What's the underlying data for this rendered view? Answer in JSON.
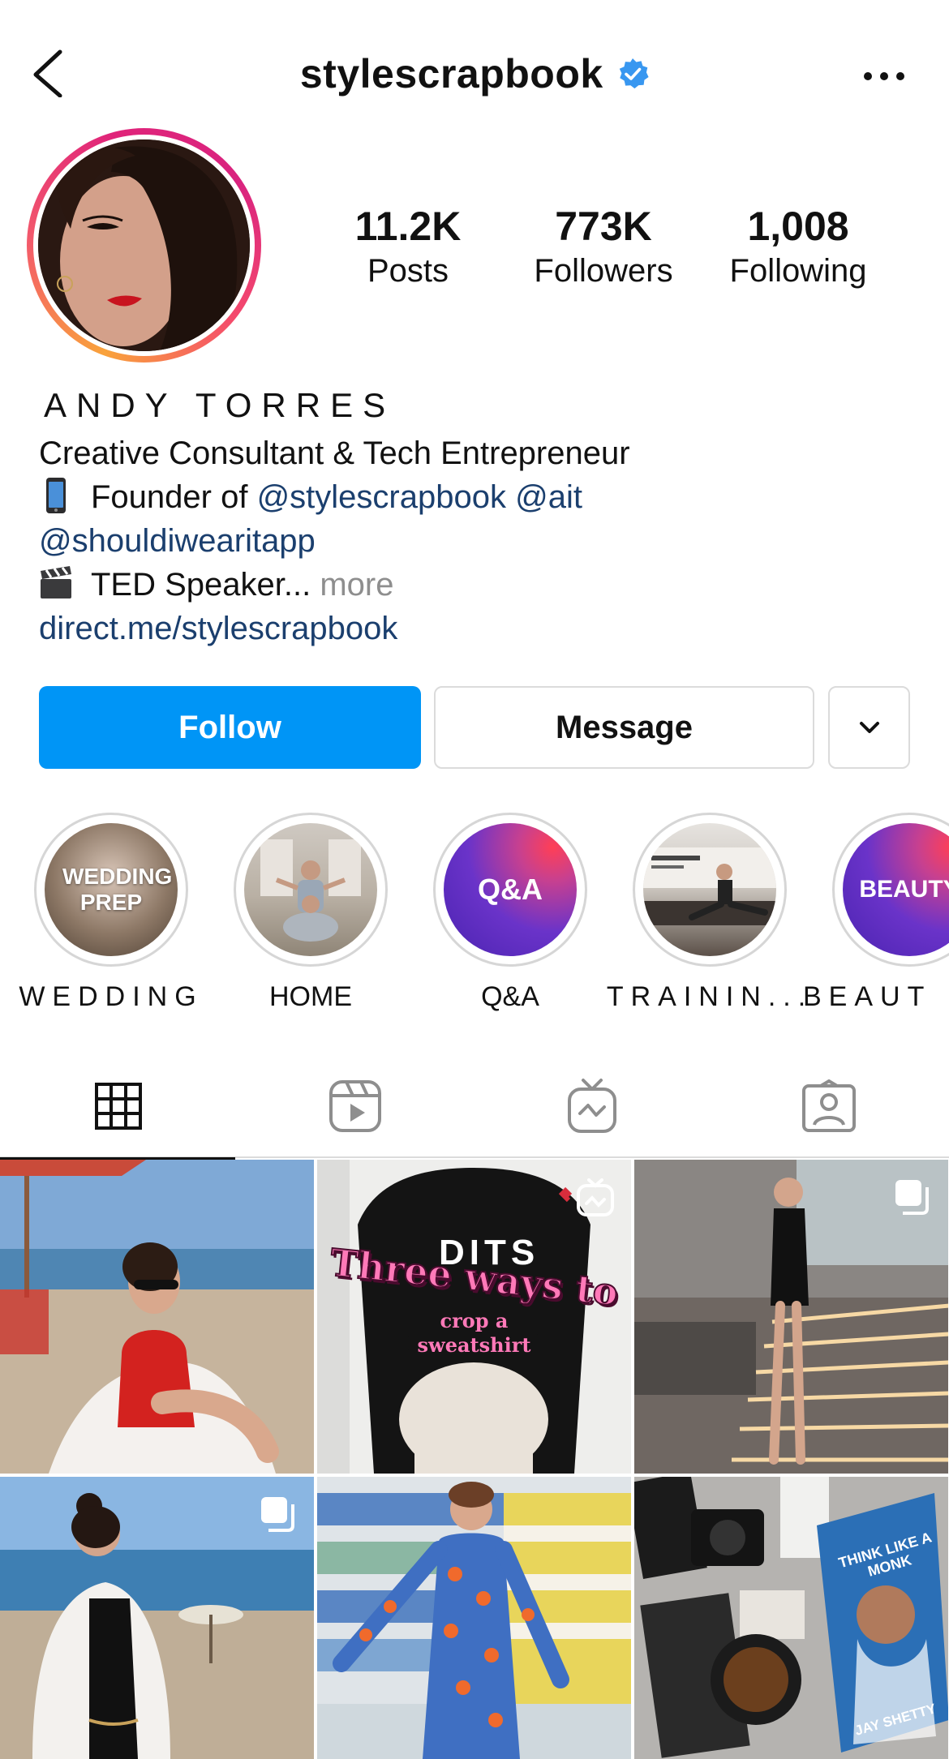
{
  "header": {
    "username": "stylescrapbook",
    "verified_icon": "verified-badge-icon",
    "back_icon": "chevron-left-icon",
    "more_icon": "more-horizontal-icon"
  },
  "profile": {
    "avatar_icon": "profile-avatar",
    "stats": [
      {
        "value": "11.2K",
        "label": "Posts"
      },
      {
        "value": "773K",
        "label": "Followers"
      },
      {
        "value": "1,008",
        "label": "Following"
      }
    ]
  },
  "bio": {
    "name": "ANDY TORRES",
    "line1": "Creative Consultant & Tech Entrepreneur",
    "line2_prefix": "Founder of ",
    "line2_mention1": "@stylescrapbook",
    "line2_mention2": "@ait",
    "line3_mention": "@shouldiwearitapp",
    "line4_text": "TED Speaker...",
    "line4_more": " more",
    "website": "direct.me/stylescrapbook"
  },
  "actions": {
    "follow_label": "Follow",
    "message_label": "Message",
    "dropdown_icon": "chevron-down-icon"
  },
  "highlights": [
    {
      "label": "WEDDING",
      "cover_text": "WEDDING PREP"
    },
    {
      "label": "HOME",
      "cover_text": ""
    },
    {
      "label": "Q&A",
      "cover_text": "Q&A"
    },
    {
      "label": "TRAININ...",
      "cover_text": ""
    },
    {
      "label": "BEAUT",
      "cover_text": "BEAUTY"
    }
  ],
  "tabs": [
    {
      "name": "posts",
      "icon": "grid-icon",
      "active": true
    },
    {
      "name": "reels",
      "icon": "reels-icon",
      "active": false
    },
    {
      "name": "igtv",
      "icon": "igtv-icon",
      "active": false
    },
    {
      "name": "tagged",
      "icon": "tagged-user-icon",
      "active": false
    }
  ],
  "posts": {
    "post2_text_line1": "Three ways to",
    "post2_text_line2": "crop a",
    "post2_text_line3": "sweatshirt",
    "post2_shirt_text": "DITS",
    "post6_book_title": "THINK LIKE A MONK",
    "post6_book_author": "JAY SHETTY"
  },
  "colors": {
    "accent": "#0095f6",
    "link": "#1b3f6e",
    "muted": "#8e8e8e",
    "verified": "#3897f0"
  }
}
